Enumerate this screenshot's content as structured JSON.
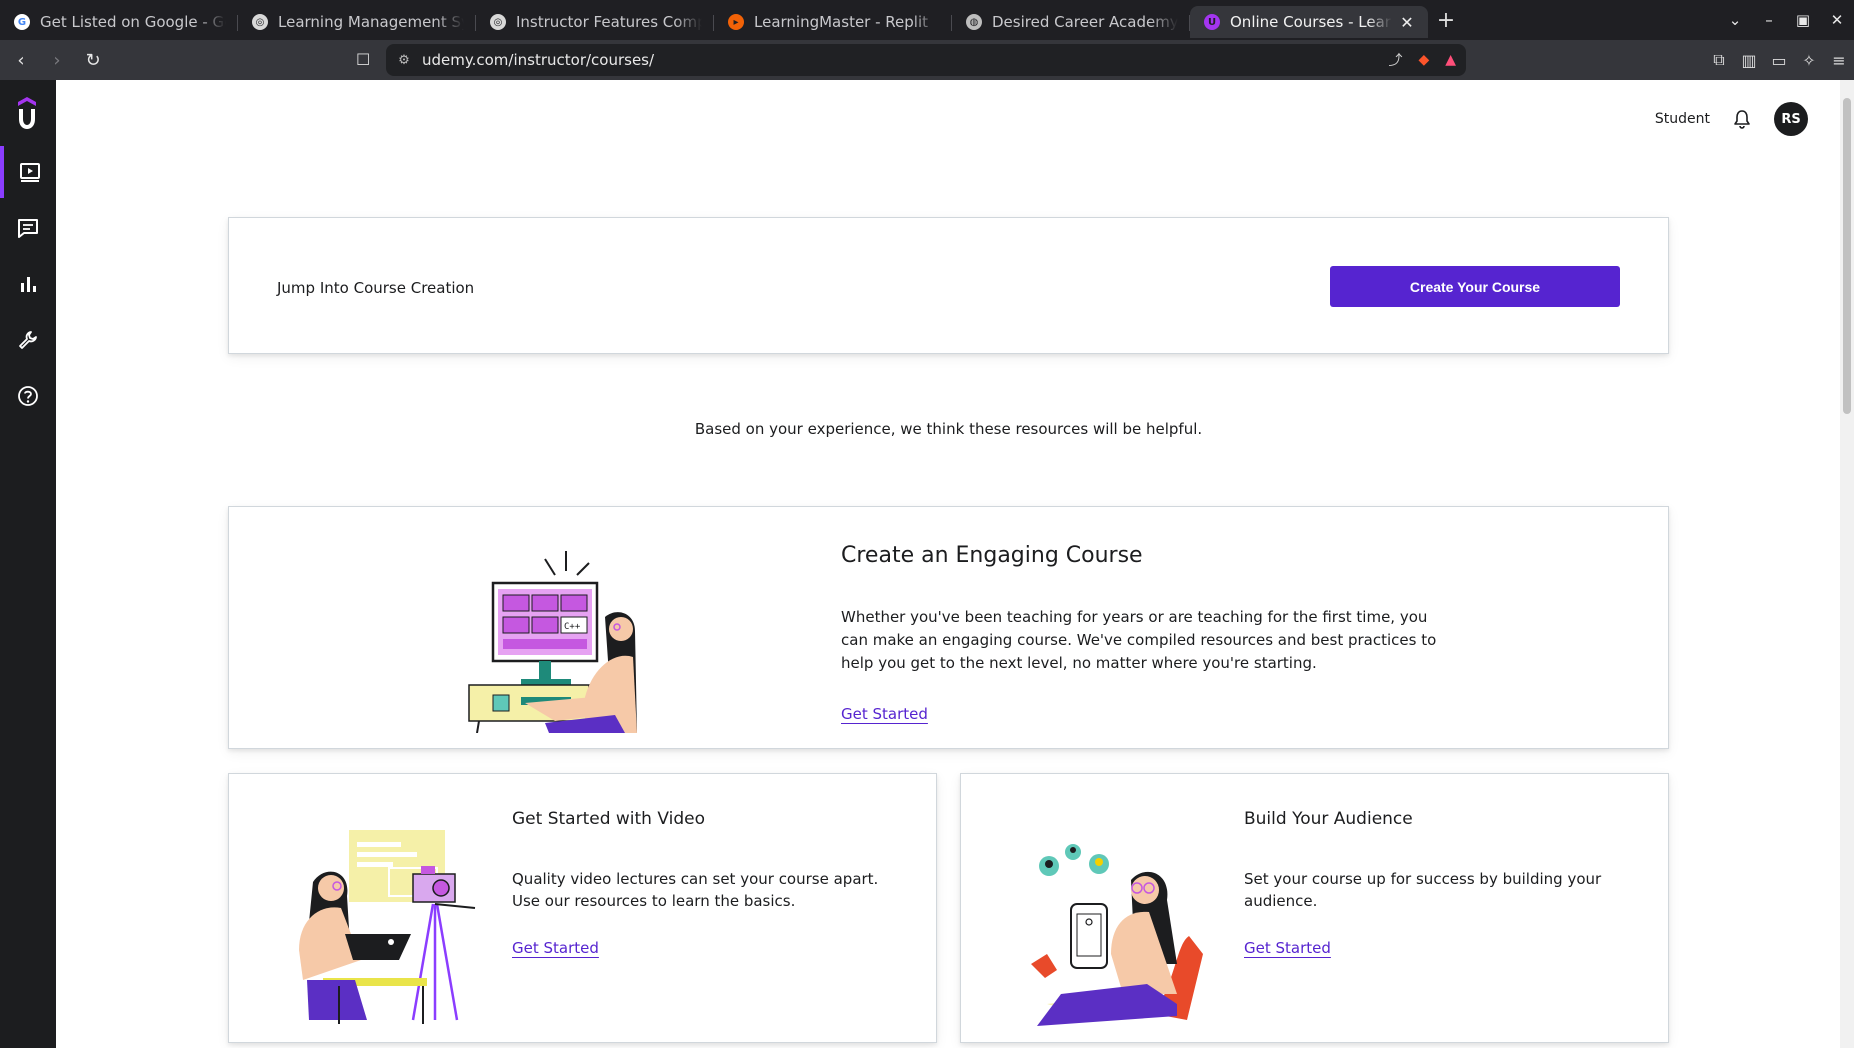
{
  "browser": {
    "tabs": [
      {
        "title": "Get Listed on Google - Goog",
        "favicon": "google-icon",
        "favicon_color": "#ffffff",
        "glyph": "G"
      },
      {
        "title": "Learning Management Syste",
        "favicon": "openai-icon",
        "favicon_color": "#d8d8d8",
        "glyph": "◎"
      },
      {
        "title": "Instructor Features Compari",
        "favicon": "openai-icon",
        "favicon_color": "#d8d8d8",
        "glyph": "◎"
      },
      {
        "title": "LearningMaster - Replit",
        "favicon": "replit-icon",
        "favicon_color": "#f26207",
        "glyph": "▸"
      },
      {
        "title": "Desired Career Academy | Er",
        "favicon": "globe-icon",
        "favicon_color": "#bdbdbd",
        "glyph": "◍"
      },
      {
        "title": "Online Courses - Learn A",
        "favicon": "udemy-icon",
        "favicon_color": "#a435f0",
        "glyph": "U",
        "active": true
      }
    ],
    "url": "udemy.com/instructor/courses/"
  },
  "header": {
    "student_label": "Student",
    "avatar_initials": "RS"
  },
  "jump": {
    "label": "Jump Into Course Creation",
    "button": "Create Your Course"
  },
  "helpful_text": "Based on your experience, we think these resources will be helpful.",
  "cards": {
    "engage": {
      "title": "Create an Engaging Course",
      "text": "Whether you've been teaching for years or are teaching for the first time, you can make an engaging course. We've compiled resources and best practices to help you get to the next level, no matter where you're starting.",
      "link": "Get Started"
    },
    "video": {
      "title": "Get Started with Video",
      "text": "Quality video lectures can set your course apart. Use our resources to learn the basics.",
      "link": "Get Started"
    },
    "audience": {
      "title": "Build Your Audience",
      "text": "Set your course up for success by building your audience.",
      "link": "Get Started"
    }
  },
  "colors": {
    "brand_purple": "#5624d0",
    "sidebar_bg": "#1c1d1f",
    "accent": "#a435f0"
  },
  "icons": {
    "sidebar": [
      "courses-icon",
      "communication-icon",
      "performance-icon",
      "tools-icon",
      "help-icon"
    ]
  }
}
